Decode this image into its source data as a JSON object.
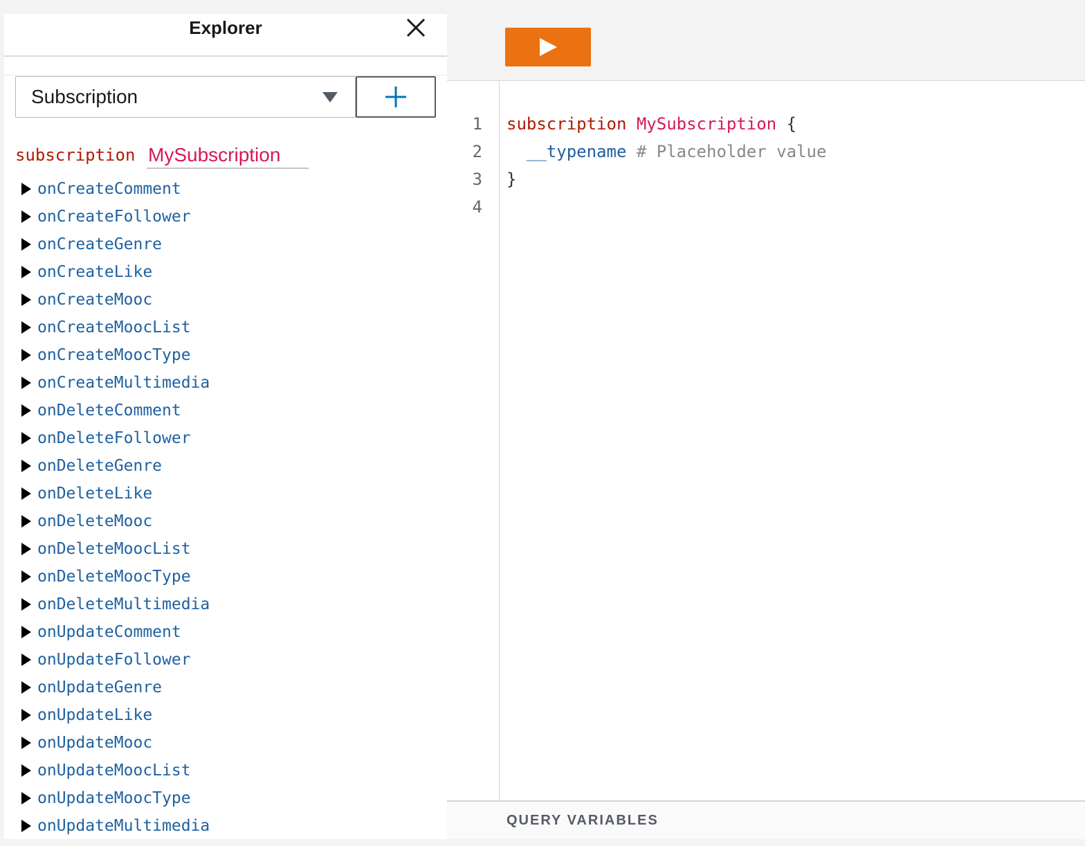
{
  "explorer": {
    "title": "Explorer",
    "operation_type": "Subscription",
    "operation_keyword": "subscription",
    "operation_name": "MySubscription",
    "fields": [
      "onCreateComment",
      "onCreateFollower",
      "onCreateGenre",
      "onCreateLike",
      "onCreateMooc",
      "onCreateMoocList",
      "onCreateMoocType",
      "onCreateMultimedia",
      "onDeleteComment",
      "onDeleteFollower",
      "onDeleteGenre",
      "onDeleteLike",
      "onDeleteMooc",
      "onDeleteMoocList",
      "onDeleteMoocType",
      "onDeleteMultimedia",
      "onUpdateComment",
      "onUpdateFollower",
      "onUpdateGenre",
      "onUpdateLike",
      "onUpdateMooc",
      "onUpdateMoocList",
      "onUpdateMoocType",
      "onUpdateMultimedia"
    ]
  },
  "editor": {
    "line_numbers": [
      "1",
      "2",
      "3",
      "4"
    ],
    "line1": {
      "keyword": "subscription",
      "name": "MySubscription",
      "brace": "{"
    },
    "line2": {
      "field": "__typename",
      "comment": "# Placeholder value"
    },
    "line3": {
      "brace": "}"
    },
    "query_variables_label": "QUERY VARIABLES"
  },
  "colors": {
    "run_button": "#ec7211",
    "keyword": "#b11a04",
    "operation_name": "#d6165d",
    "field": "#1f61a0",
    "comment": "#888888"
  },
  "icons": {
    "close": "close-icon",
    "caret": "caret-down-icon",
    "add": "plus-icon",
    "run": "play-icon",
    "expand": "triangle-right-icon"
  }
}
